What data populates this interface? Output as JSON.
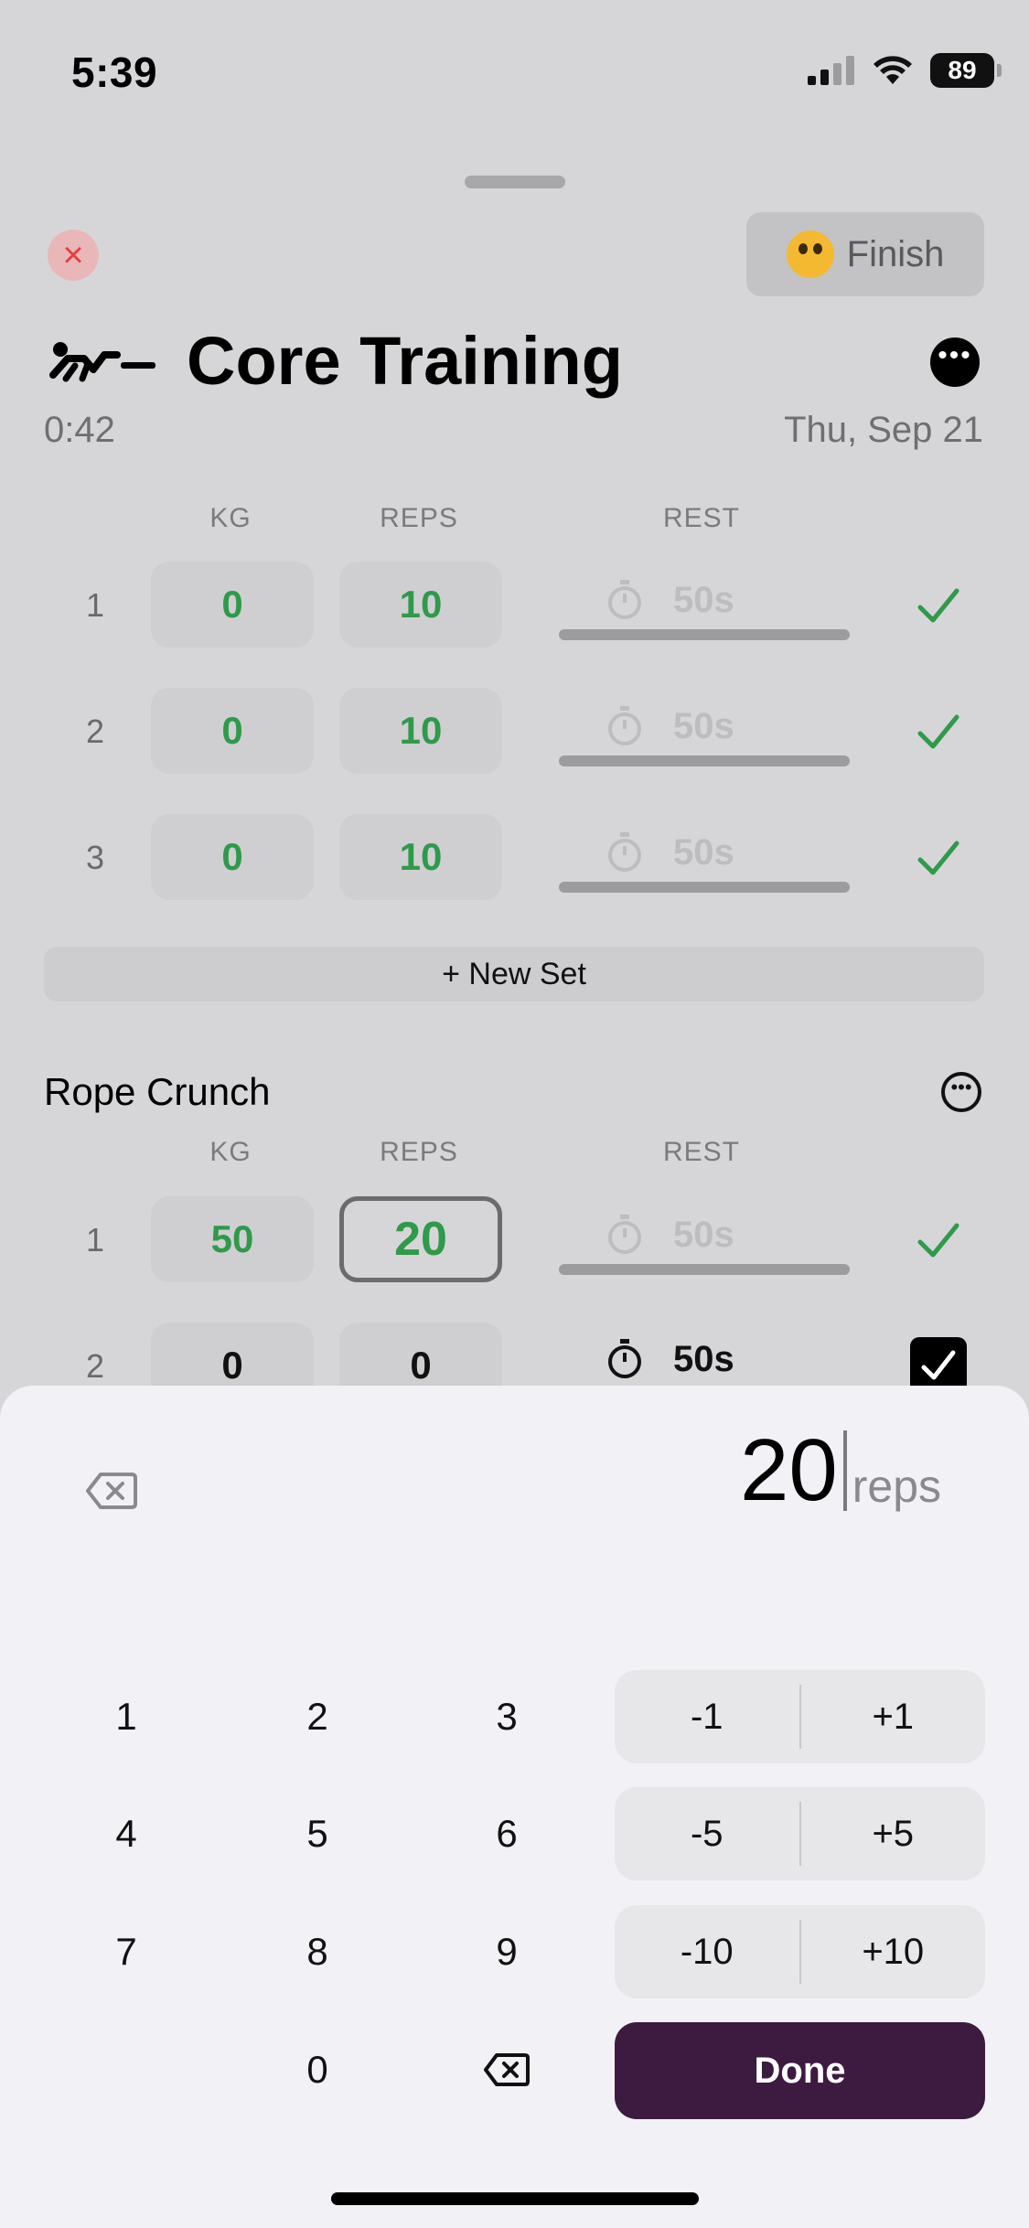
{
  "status": {
    "time": "5:39",
    "battery": "89"
  },
  "header": {
    "finish_label": "Finish",
    "title": "Core Training",
    "timer": "0:42",
    "date": "Thu, Sep 21"
  },
  "columns": {
    "kg": "KG",
    "reps": "REPS",
    "rest": "REST"
  },
  "exercise1": {
    "sets": [
      {
        "num": "1",
        "kg": "0",
        "reps": "10",
        "rest": "50s"
      },
      {
        "num": "2",
        "kg": "0",
        "reps": "10",
        "rest": "50s"
      },
      {
        "num": "3",
        "kg": "0",
        "reps": "10",
        "rest": "50s"
      }
    ],
    "new_set_label": "+ New Set"
  },
  "exercise2": {
    "name": "Rope Crunch",
    "sets": [
      {
        "num": "1",
        "kg": "50",
        "reps": "20",
        "rest": "50s"
      },
      {
        "num": "2",
        "kg": "0",
        "reps": "0",
        "rest": "50s"
      }
    ]
  },
  "keypad": {
    "value": "20",
    "unit": "reps",
    "keys": [
      "1",
      "2",
      "3",
      "4",
      "5",
      "6",
      "7",
      "8",
      "9",
      "0"
    ],
    "steps": [
      {
        "minus": "-1",
        "plus": "+1"
      },
      {
        "minus": "-5",
        "plus": "+5"
      },
      {
        "minus": "-10",
        "plus": "+10"
      }
    ],
    "done_label": "Done"
  },
  "colors": {
    "accent_green": "#2f9a4a",
    "done_button": "#3d1a3f",
    "close_red": "#e2413f"
  }
}
